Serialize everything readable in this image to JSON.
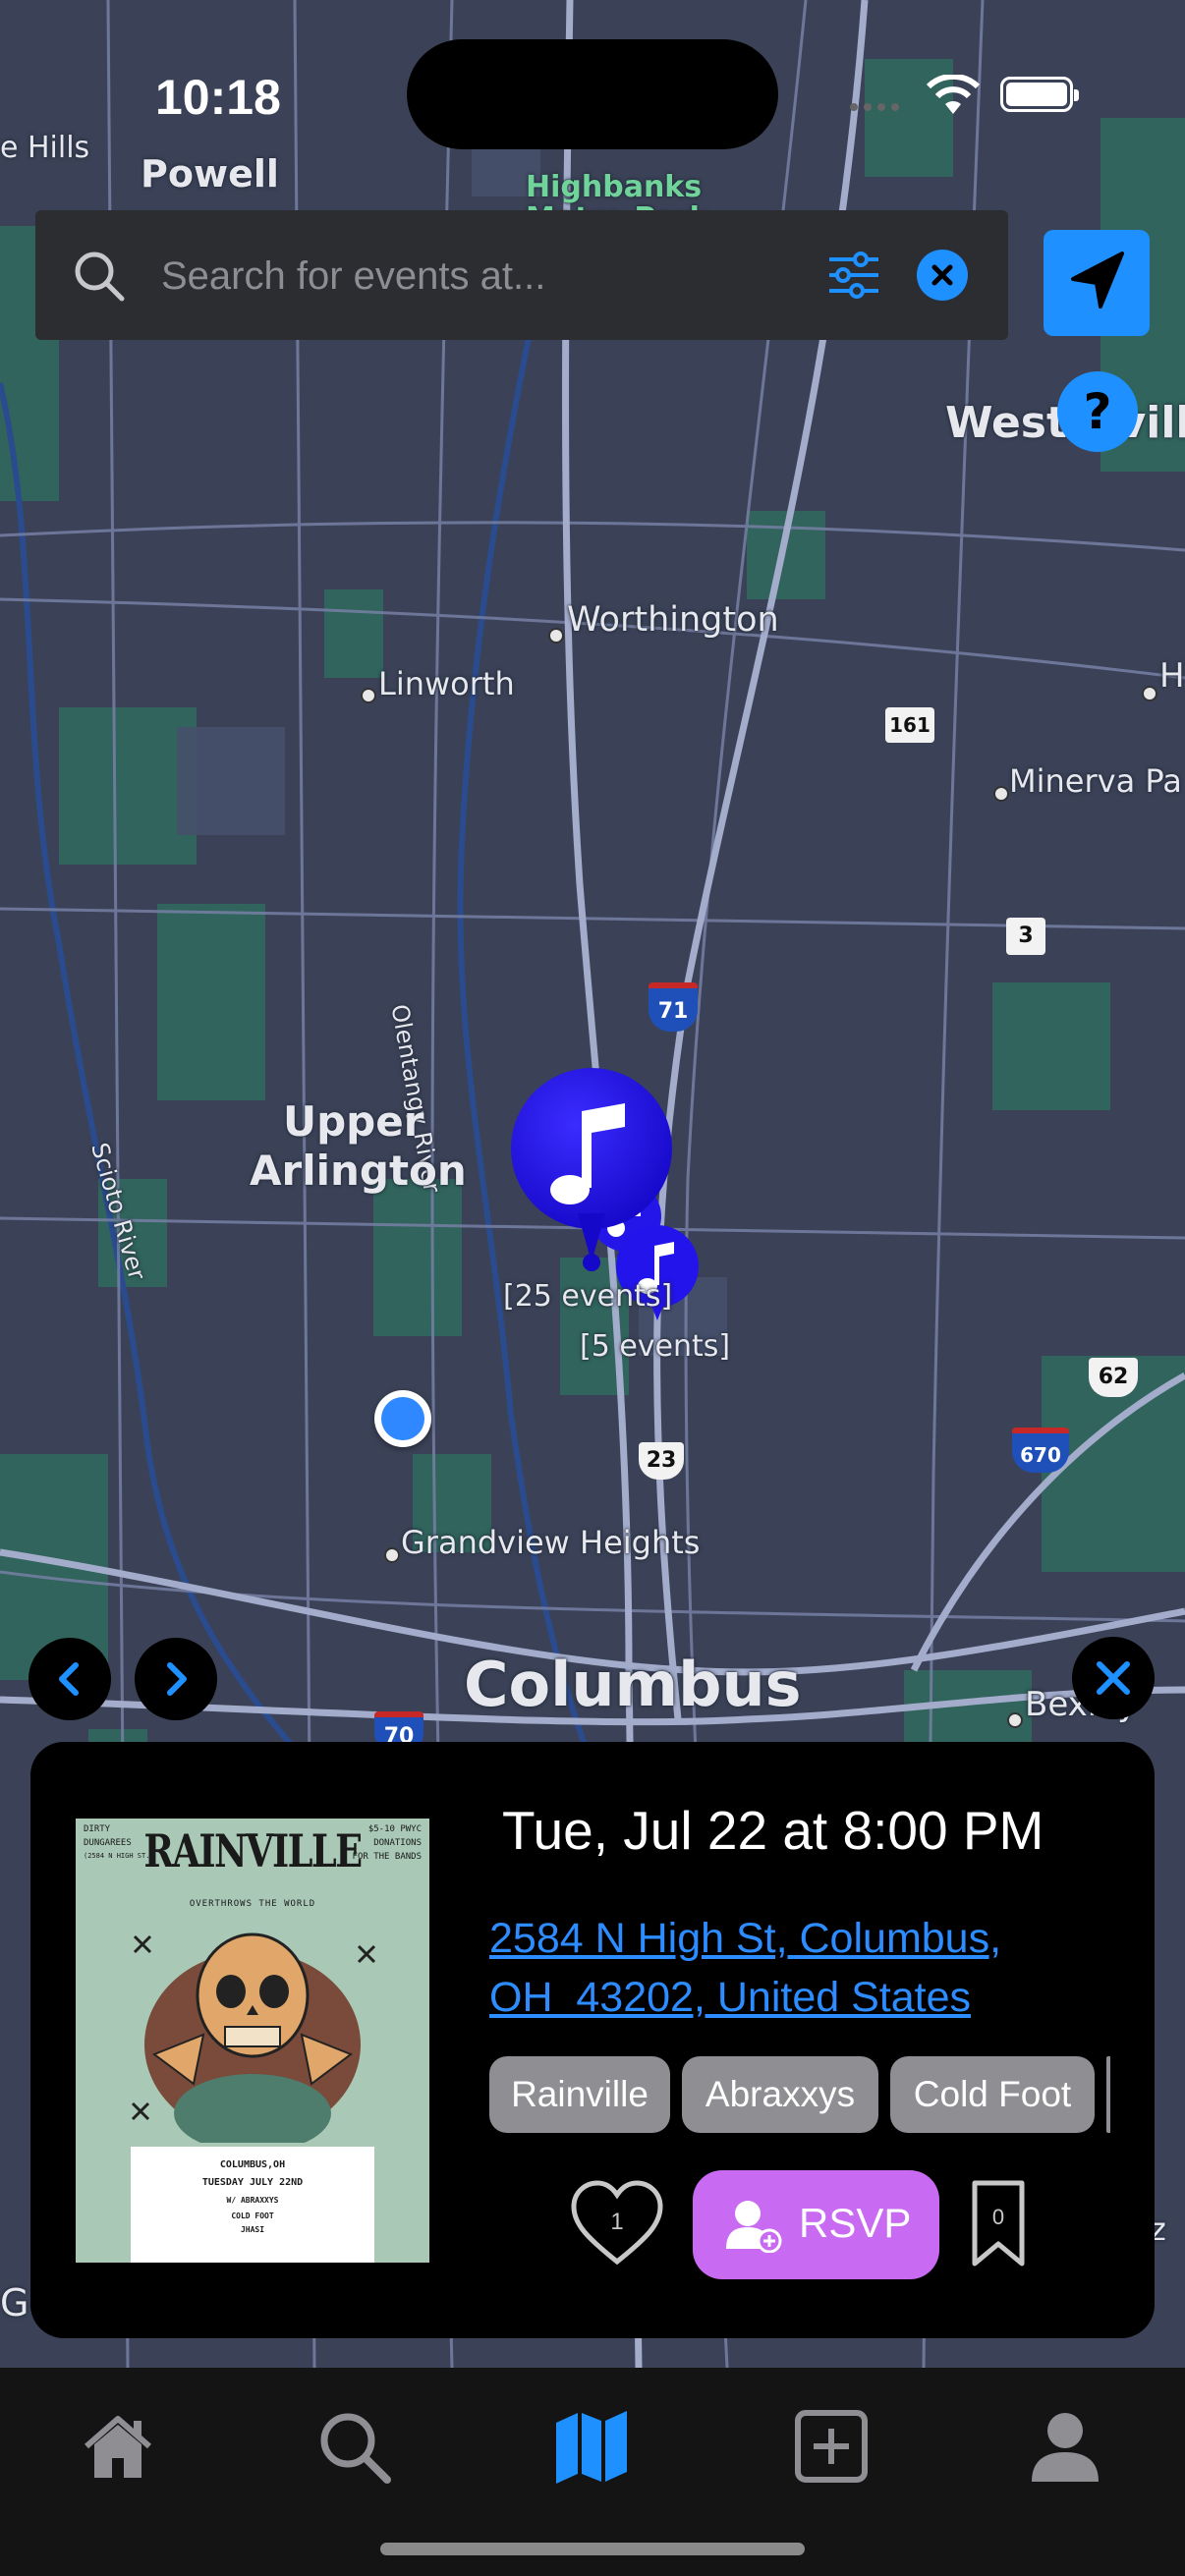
{
  "status": {
    "time": "10:18"
  },
  "search": {
    "placeholder": "Search for events at..."
  },
  "map": {
    "places": {
      "hills": "e Hills",
      "powell": "Powell",
      "highbanks": "Highbanks",
      "metro_park": "Metro Park",
      "westerville": "Westerville",
      "worthington": "Worthington",
      "linworth": "Linworth",
      "minerva_park": "Minerva Pa",
      "h_edge": "H",
      "upper_arlington_1": "Upper",
      "upper_arlington_2": "Arlington",
      "olentangy": "Olentangy River",
      "scioto": "Scioto River",
      "grandview": "Grandview Heights",
      "columbus": "Columbus",
      "bexley": "Bexley",
      "g_edge": "G",
      "z_edge": "z"
    },
    "shields": {
      "r161": "161",
      "r3": "3",
      "i71": "71",
      "r23": "23",
      "i670": "670",
      "r62": "62",
      "i70": "70"
    },
    "clusters": {
      "large": "[25 events]",
      "small": "[5 events]"
    }
  },
  "event": {
    "datetime": "Tue, Jul 22 at 8:00 PM",
    "address_line1": "2584 N High St, Columbus,",
    "address_line2": "OH  43202, United States",
    "artists": [
      "Rainville",
      "Abraxxys",
      "Cold Foot"
    ],
    "like_count": "1",
    "rsvp_label": "RSVP",
    "bookmark_count": "0",
    "poster": {
      "title": "RAINVILLE",
      "subtitle": "OVERTHROWS THE WORLD",
      "left_top": "DIRTY",
      "left_mid": "DUNGAREES",
      "left_addr": "(2584 N HIGH ST.)",
      "right_top": "$5-10 PWYC",
      "right_mid": "DONATIONS",
      "right_bot": "FOR THE BANDS",
      "city": "COLUMBUS,OH",
      "date": "TUESDAY JULY 22ND",
      "with": "W/ ABRAXXYS",
      "band2": "COLD FOOT",
      "band3": "JHASI"
    }
  },
  "colors": {
    "accent": "#1e90ff",
    "rsvp": "#c86af2",
    "chip": "#8e8e93",
    "pin": "#1a10ee"
  },
  "tabbar": [
    "home-icon",
    "search-icon",
    "map-icon",
    "add-icon",
    "profile-icon"
  ]
}
